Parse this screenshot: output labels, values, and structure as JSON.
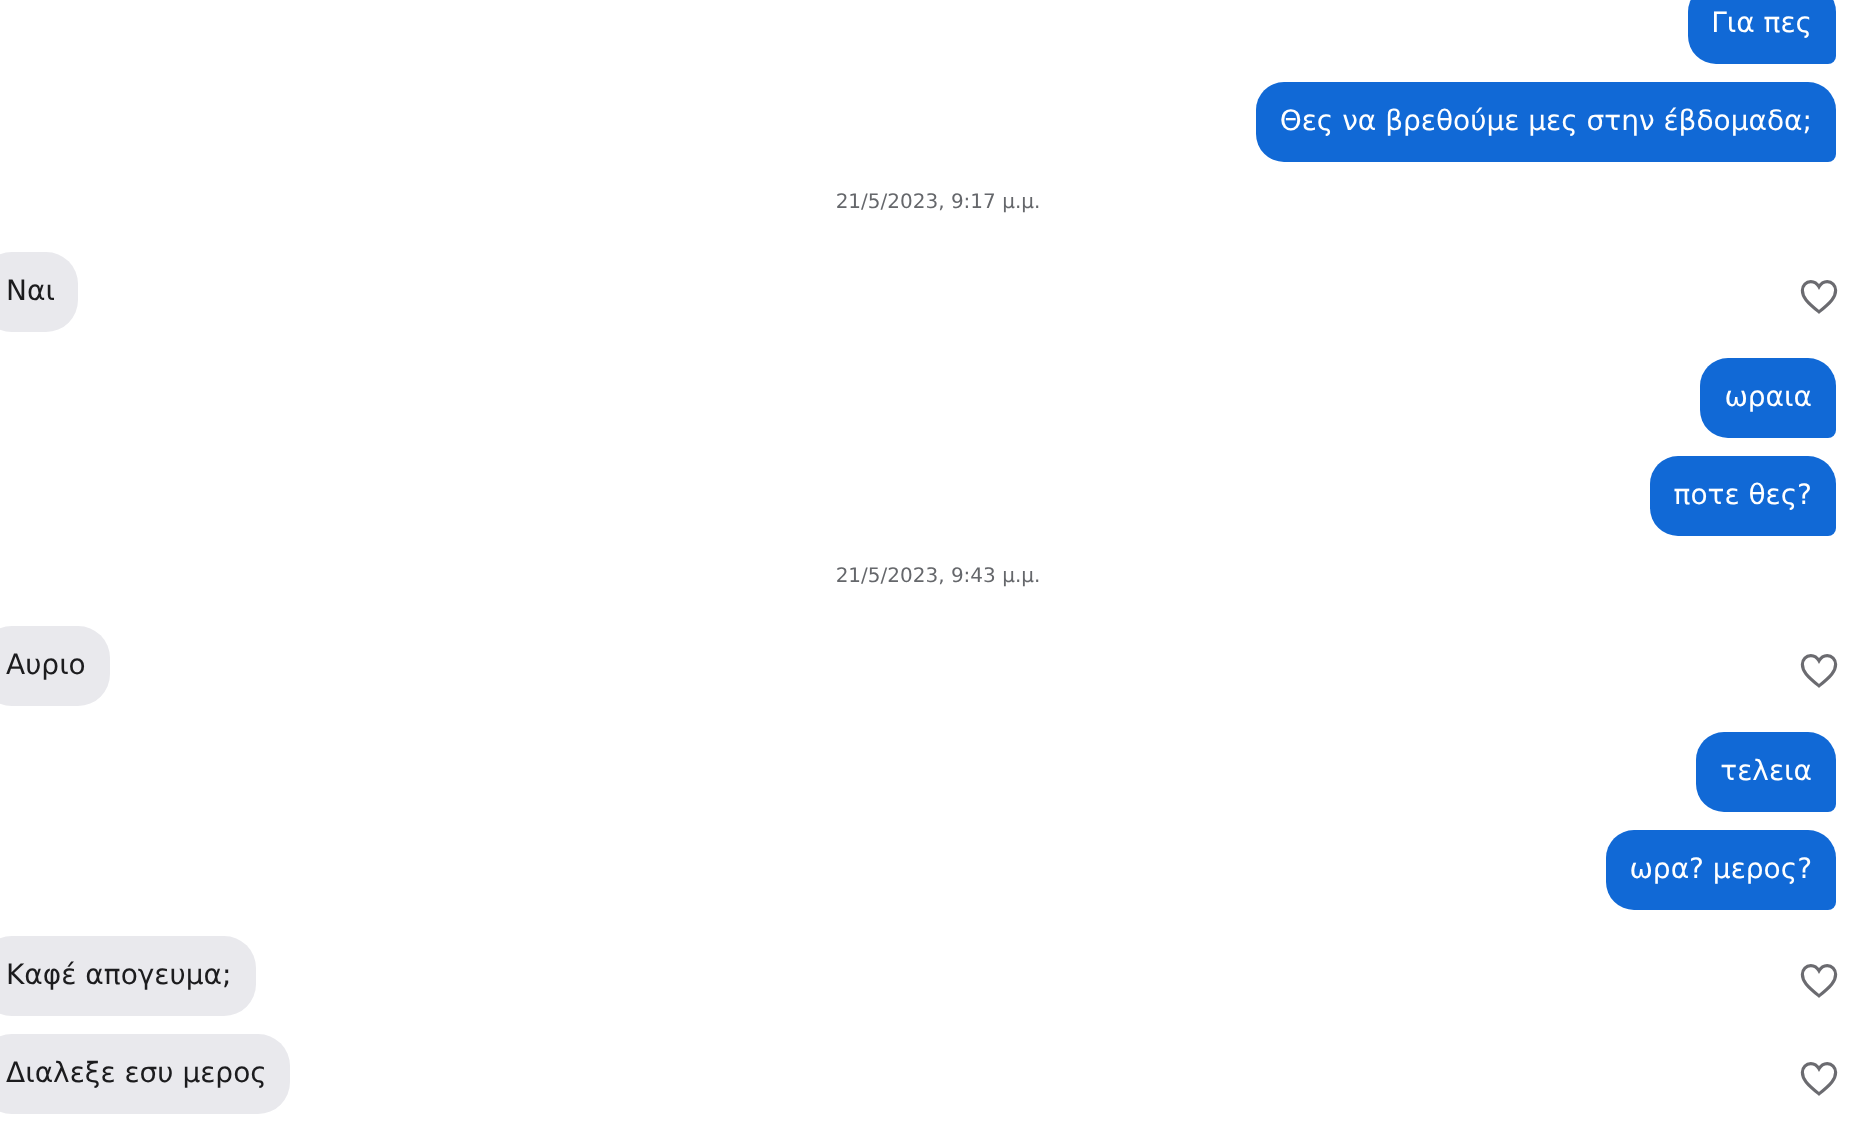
{
  "messages": [
    {
      "kind": "sent",
      "text": "Για πες"
    },
    {
      "kind": "sent",
      "text": "Θες να βρεθούμε μες στην έβδομαδα;"
    },
    {
      "kind": "timestamp",
      "text": "21/5/2023, 9:17 μ.μ."
    },
    {
      "kind": "received",
      "text": "Ναι",
      "liked": false
    },
    {
      "kind": "sent",
      "text": "ωραια"
    },
    {
      "kind": "sent",
      "text": "ποτε θες?"
    },
    {
      "kind": "timestamp",
      "text": "21/5/2023, 9:43 μ.μ."
    },
    {
      "kind": "received",
      "text": "Αυριο",
      "liked": false
    },
    {
      "kind": "sent",
      "text": "τελεια"
    },
    {
      "kind": "sent",
      "text": "ωρα? μερος?"
    },
    {
      "kind": "received",
      "text": "Καφέ απογευμα;",
      "liked": false
    },
    {
      "kind": "received",
      "text": "Διαλεξε εσυ μερος",
      "liked": false
    }
  ]
}
